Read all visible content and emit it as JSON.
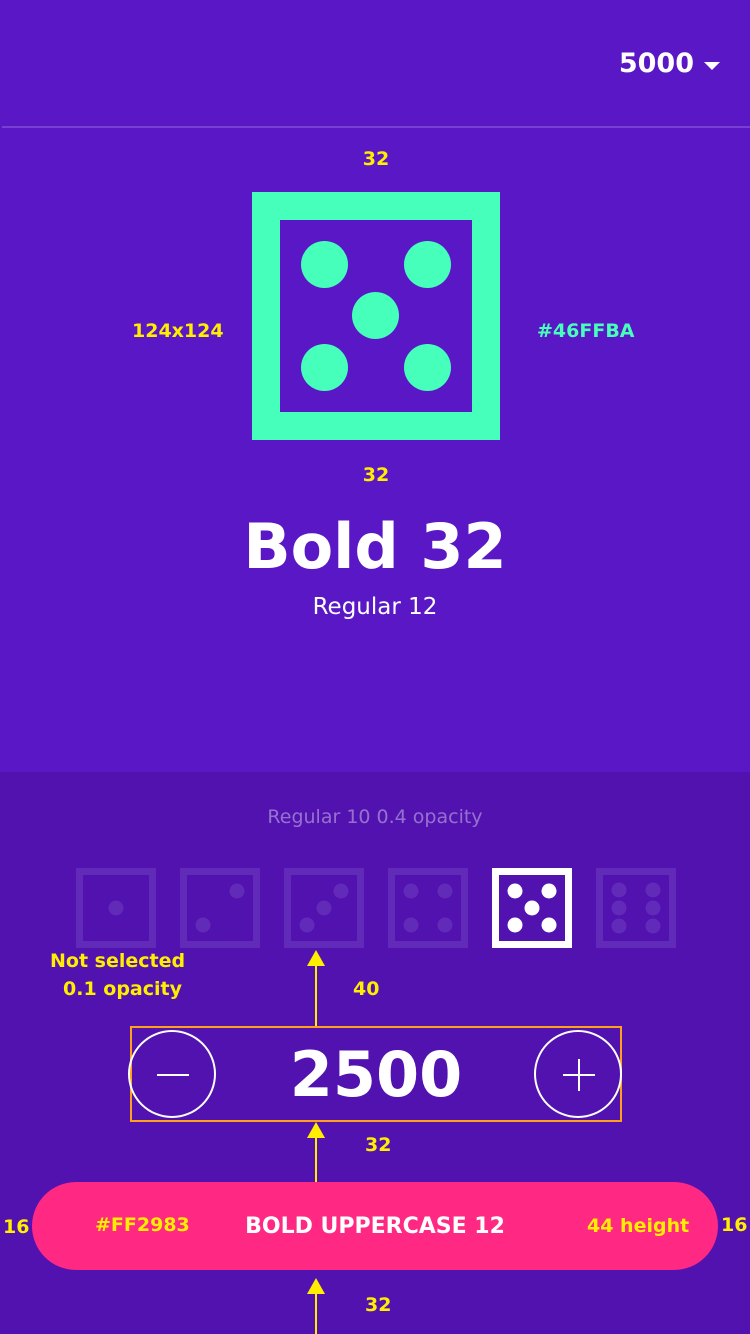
{
  "header": {
    "balance": "5000"
  },
  "spec": {
    "top_gap": "32",
    "bottom_gap": "32",
    "size": "124x124",
    "color": "#46FFBA",
    "color_hex": "#46ffba"
  },
  "title": "Bold 32",
  "subtitle": "Regular 12",
  "hint": "Regular 10 0.4 opacity",
  "dice": {
    "faces": [
      1,
      2,
      3,
      4,
      5,
      6
    ],
    "selected_face": 5,
    "not_selected_line1": "Not selected",
    "not_selected_line2": "0.1  opacity",
    "gap": "40"
  },
  "stepper": {
    "value": "2500",
    "gap_below": "32"
  },
  "cta": {
    "label": "BOLD UPPERCASE 12",
    "color": "#FF2983",
    "height_note": "44 height",
    "side_margin_left": "16",
    "side_margin_right": "16",
    "gap_below": "32"
  },
  "colors": {
    "background": "#5a17c6",
    "bottom_panel": "#5112b0",
    "accent": "#46ffba",
    "button": "#ff2983",
    "annotation": "#ffee00"
  }
}
